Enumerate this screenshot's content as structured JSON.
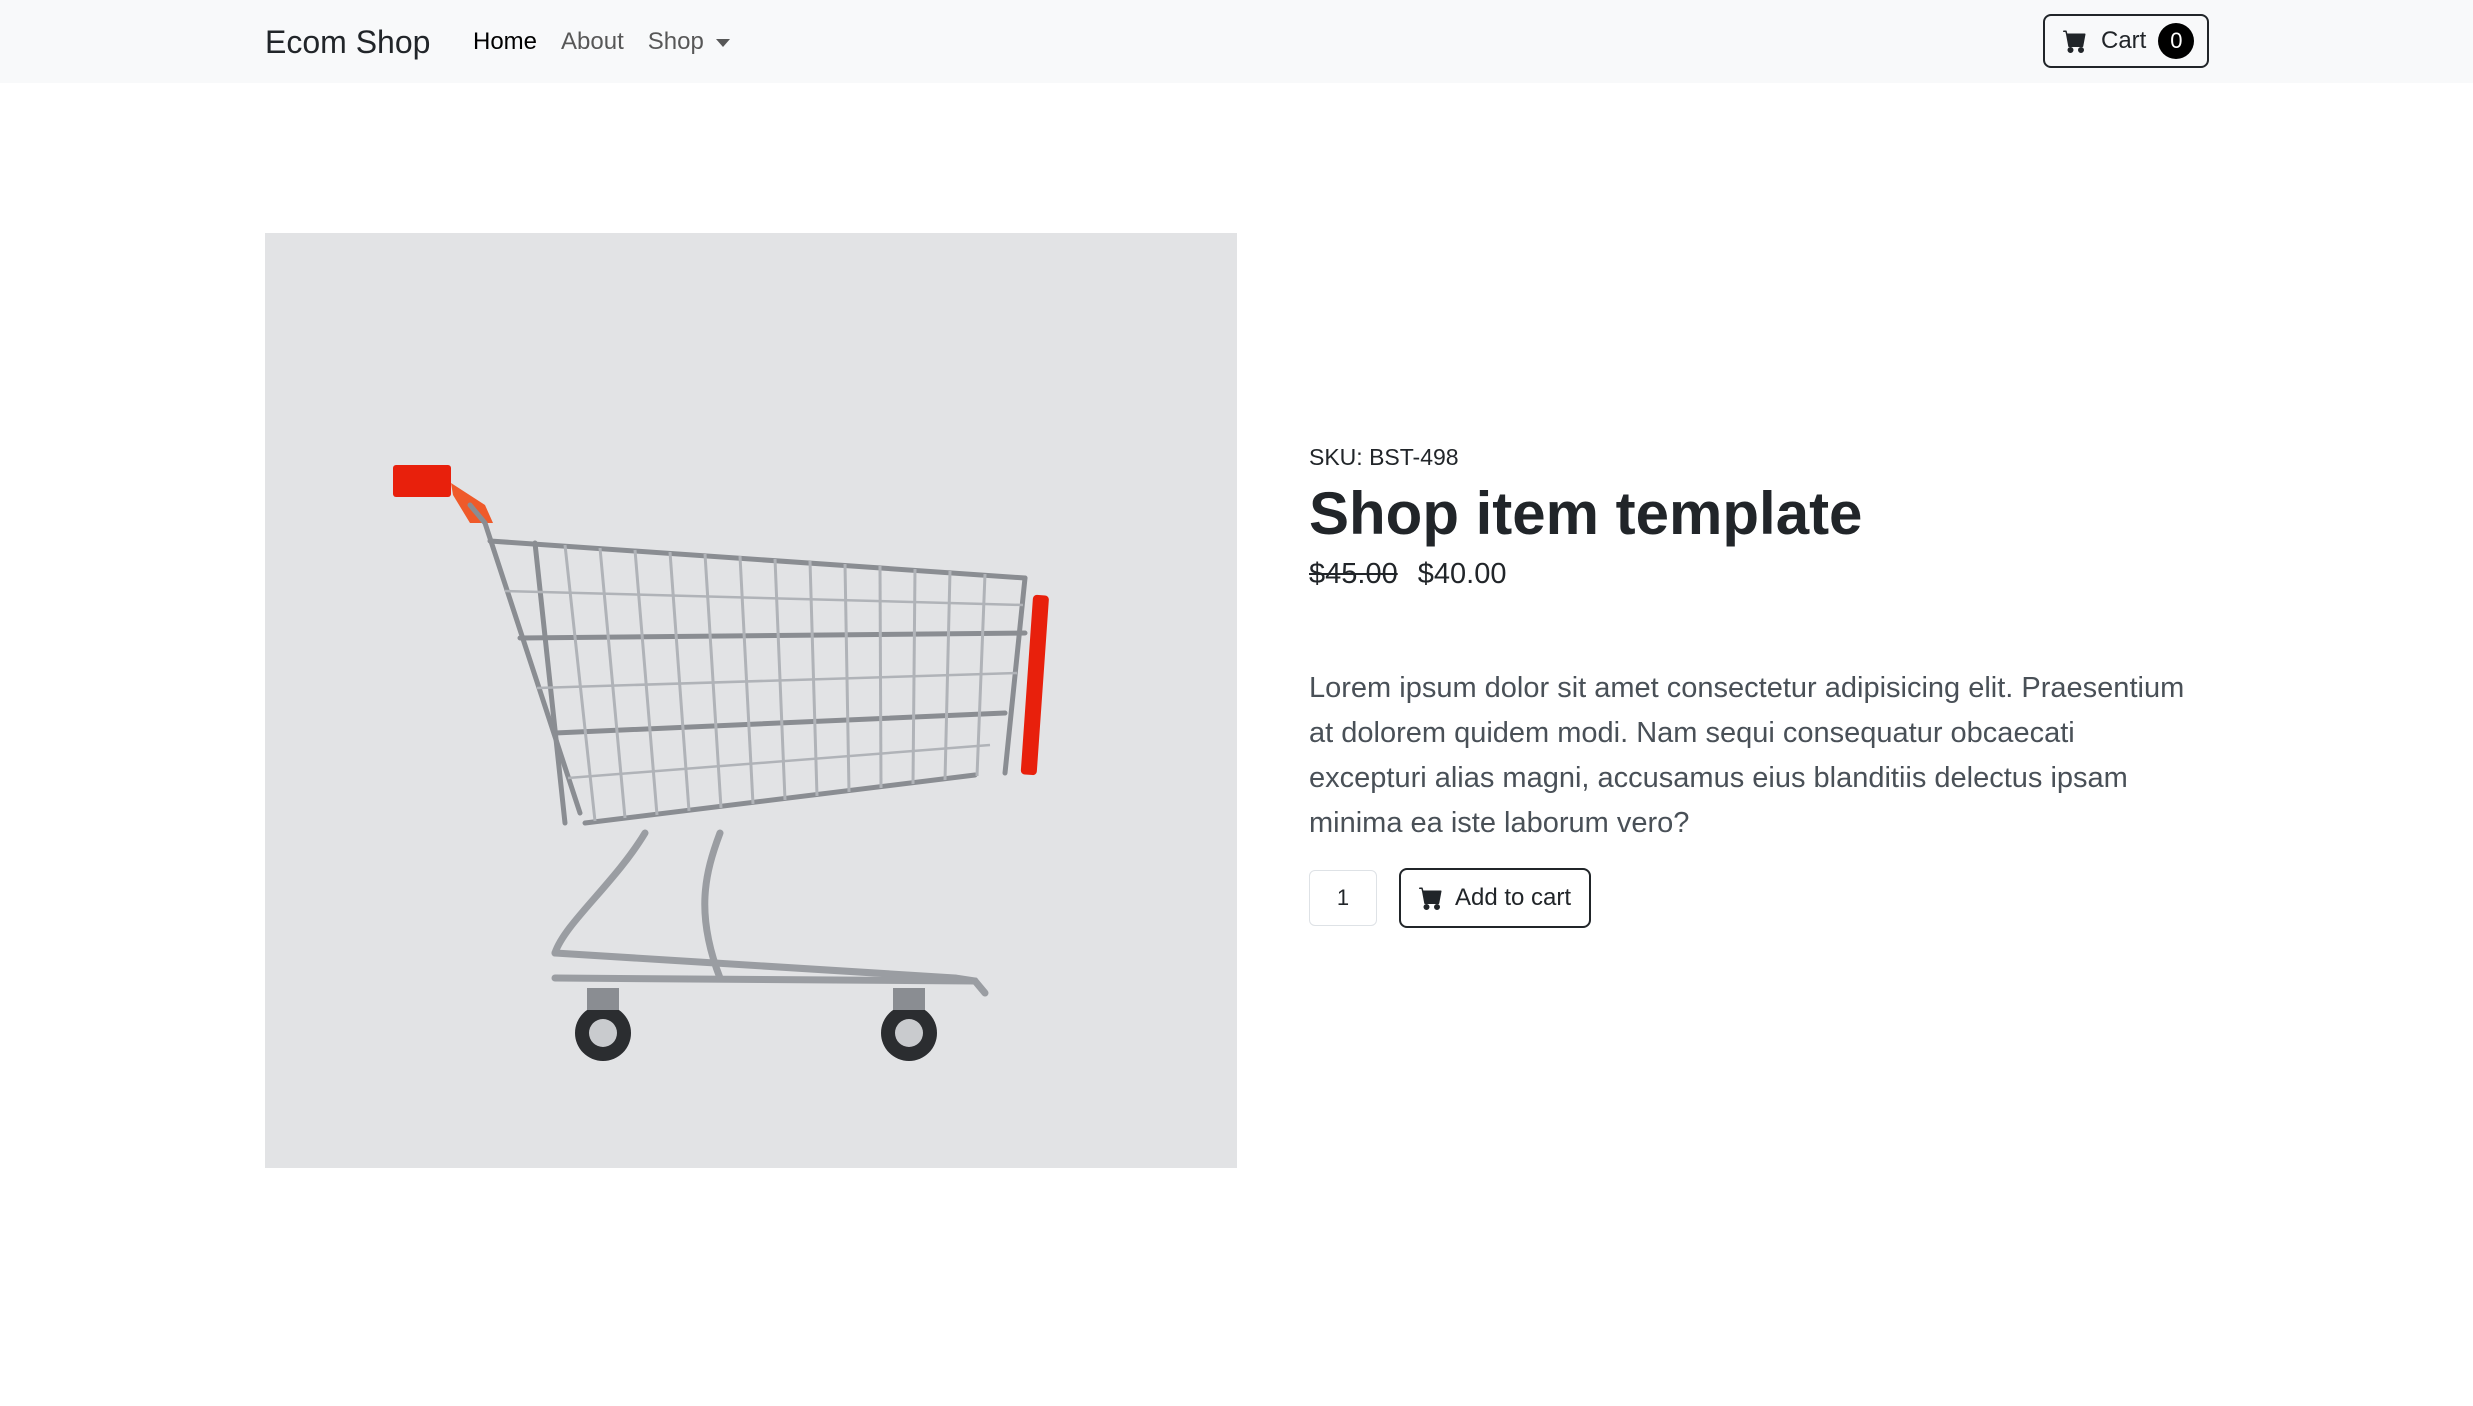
{
  "navbar": {
    "brand": "Ecom Shop",
    "links": [
      {
        "label": "Home",
        "active": true
      },
      {
        "label": "About",
        "active": false
      },
      {
        "label": "Shop",
        "active": false,
        "dropdown": true
      }
    ],
    "cart": {
      "label": "Cart",
      "count": "0",
      "icon": "cart-icon"
    }
  },
  "product": {
    "image_alt": "shopping-cart-photo",
    "sku": "SKU: BST-498",
    "title": "Shop item template",
    "old_price": "$45.00",
    "price": "$40.00",
    "description": "Lorem ipsum dolor sit amet consectetur adipisicing elit. Praesentium at dolorem quidem modi. Nam sequi consequatur obcaecati excepturi alias magni, accusamus eius blanditiis delectus ipsam minima ea iste laborum vero?",
    "quantity": "1",
    "add_to_cart_label": "Add to cart",
    "add_to_cart_icon": "cart-icon"
  },
  "colors": {
    "navbar_bg": "#f8f9fa",
    "image_bg": "#e2e3e5",
    "text_dark": "#212529",
    "text_muted": "#495057",
    "cart_handle": "#e8200c"
  }
}
